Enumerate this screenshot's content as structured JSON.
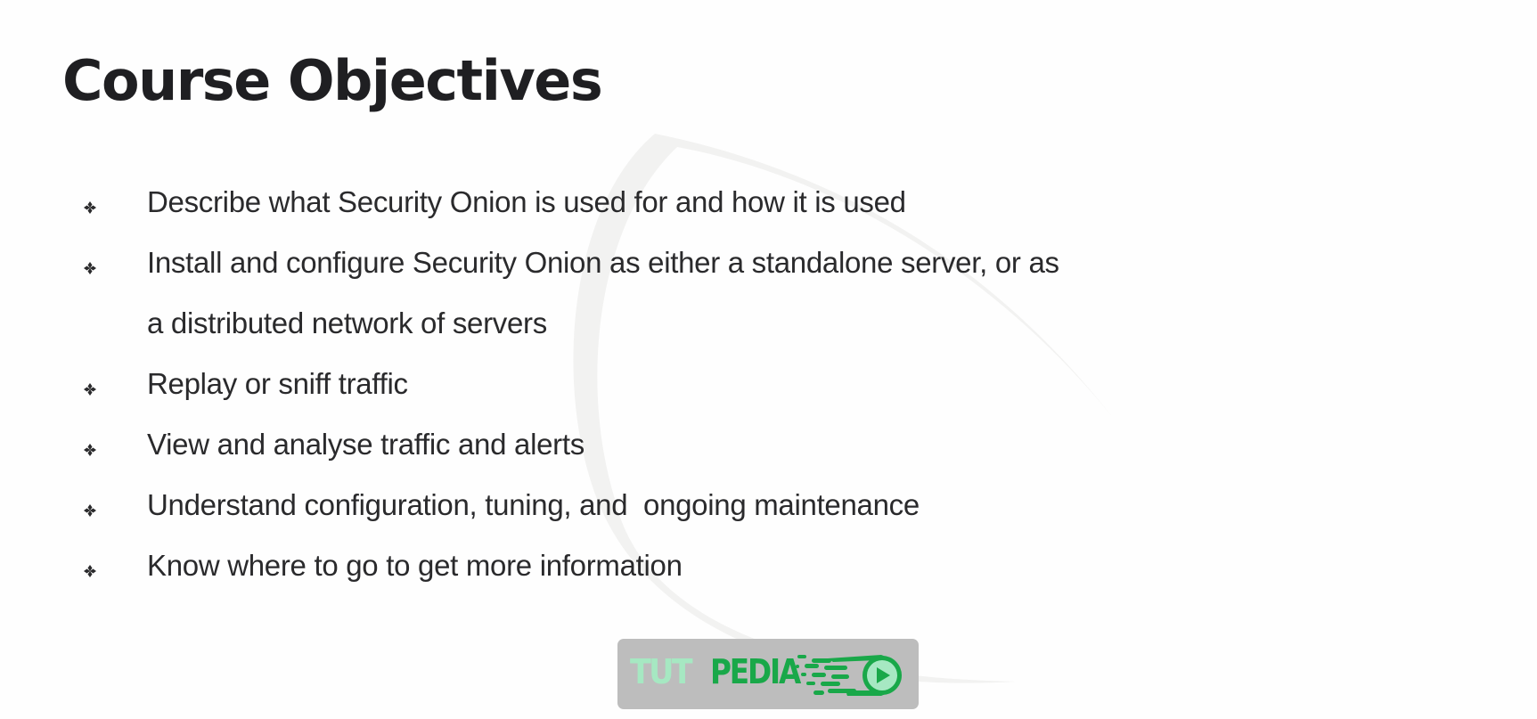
{
  "slide": {
    "title": "Course Objectives",
    "objectives": [
      {
        "lines": [
          "Describe what Security Onion is used for and how it is used"
        ]
      },
      {
        "lines": [
          "Install and configure Security Onion as either a standalone server, or as",
          "a distributed network of servers"
        ]
      },
      {
        "lines": [
          "Replay or sniff traffic"
        ]
      },
      {
        "lines": [
          "View and analyse traffic and alerts"
        ]
      },
      {
        "lines": [
          "Understand configuration, tuning, and  ongoing maintenance"
        ]
      },
      {
        "lines": [
          "Know where to go to get more information"
        ]
      }
    ],
    "bullet_icon": "diamond-four-bullet-icon"
  },
  "logo": {
    "part1": "TUT",
    "part2": "PEDIA",
    "icon": "play-circle-icon",
    "colors": {
      "background": "#bdbdbd",
      "part1": "#a6e8c2",
      "part2": "#19a849"
    }
  },
  "colors": {
    "title": "#1f1f22",
    "text": "#2a2a2c",
    "watermark": "#f0f0ee"
  }
}
